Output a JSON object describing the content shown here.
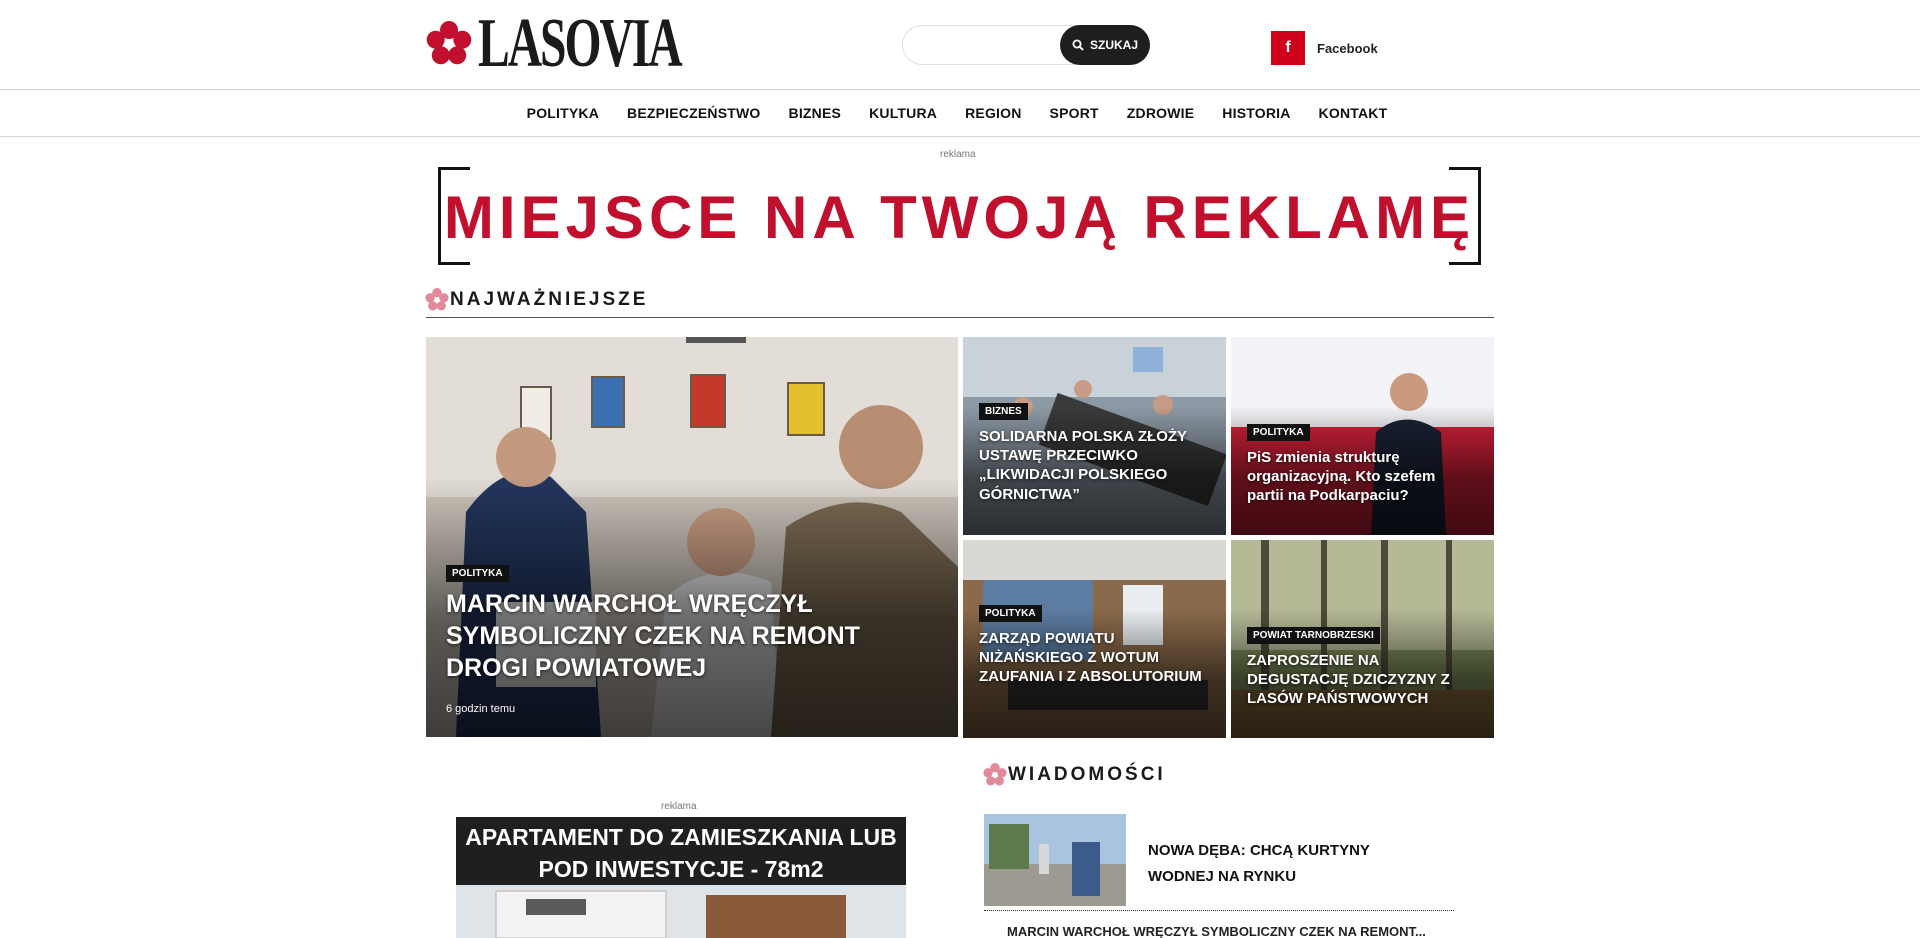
{
  "brand": {
    "name": "LASOVIA"
  },
  "search": {
    "placeholder": "",
    "button_label": "SZUKAJ"
  },
  "social": {
    "facebook_label": "Facebook"
  },
  "nav": {
    "items": [
      "POLITYKA",
      "BEZPIECZEŃSTWO",
      "BIZNES",
      "KULTURA",
      "REGION",
      "SPORT",
      "ZDROWIE",
      "HISTORIA",
      "KONTAKT"
    ]
  },
  "top_ad": {
    "label": "reklama",
    "text": "MIEJSCE NA TWOJĄ REKLAMĘ"
  },
  "featured": {
    "title": "NAJWAŻNIEJSZE",
    "main": {
      "category": "POLITYKA",
      "title": "MARCIN WARCHOŁ WRĘCZYŁ SYMBOLICZNY CZEK NA REMONT DROGI POWIATOWEJ",
      "time": "6 godzin temu"
    },
    "tiles": [
      {
        "category": "BIZNES",
        "title": "SOLIDARNA POLSKA ZŁOŻY USTAWĘ PRZECIWKO „LIKWIDACJI POLSKIEGO GÓRNICTWA”"
      },
      {
        "category": "POLITYKA",
        "title": "PiS zmienia strukturę organizacyjną. Kto szefem partii na Podkarpaciu?"
      },
      {
        "category": "POLITYKA",
        "title": "ZARZĄD POWIATU NIŻAŃSKIEGO Z WOTUM ZAUFANIA I Z ABSOLUTORIUM"
      },
      {
        "category": "POWIAT TARNOBRZESKI",
        "title": "ZAPROSZENIE NA DEGUSTACJĘ DZICZYZNY Z LASÓW PAŃSTWOWYCH"
      }
    ]
  },
  "side_ad": {
    "label": "reklama",
    "text": "APARTAMENT DO ZAMIESZKANIA LUB POD INWESTYCJE - 78m2"
  },
  "news": {
    "title": "WIADOMOŚCI",
    "items": [
      {
        "title": "NOWA DĘBA: CHCĄ KURTYNY WODNEJ NA RYNKU"
      },
      {
        "title": "MARCIN WARCHOŁ WRĘCZYŁ SYMBOLICZNY CZEK NA REMONT..."
      }
    ]
  },
  "colors": {
    "accent": "#c0102d",
    "facebook": "#d0021b",
    "dark": "#1e1e1e"
  }
}
